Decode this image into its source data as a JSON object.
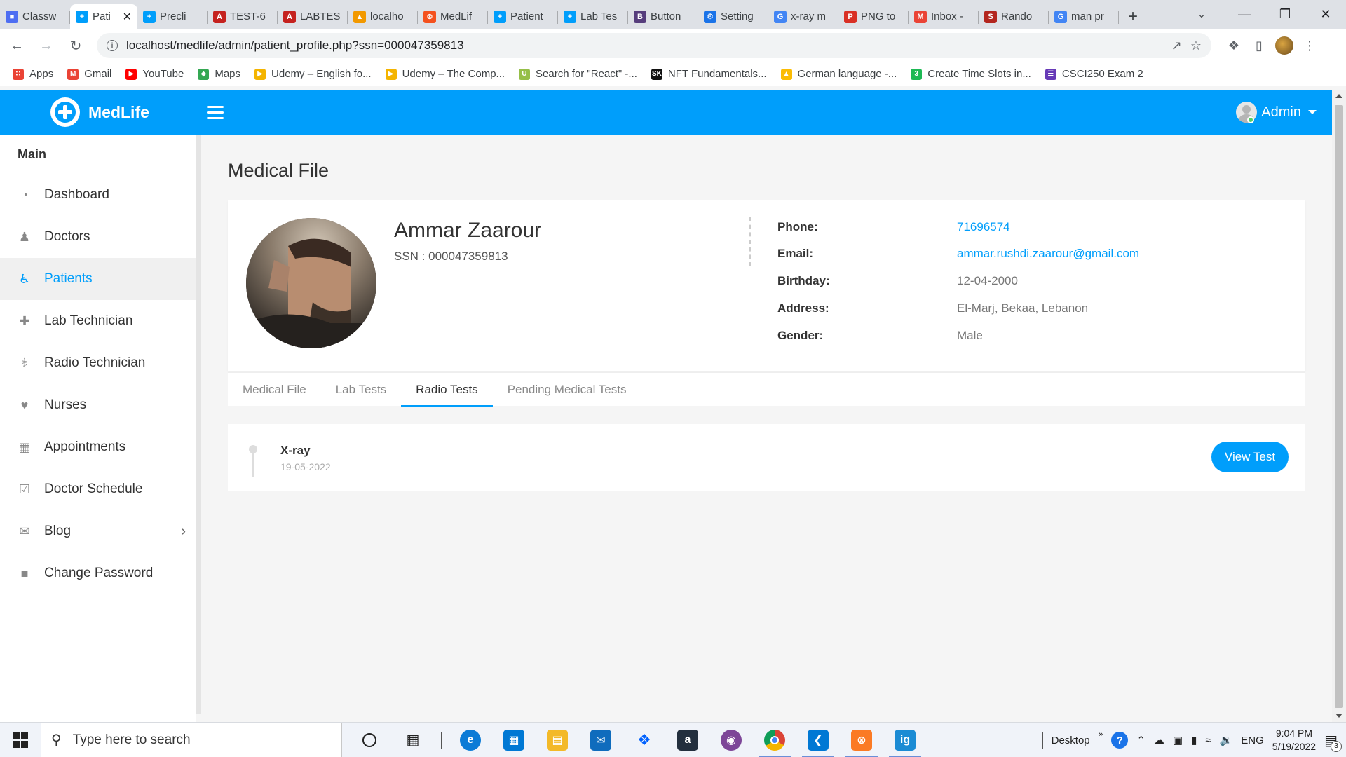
{
  "browser": {
    "tabs": [
      {
        "label": "Classw",
        "color": "#4e6ef2",
        "glyph": "■",
        "active": false
      },
      {
        "label": "Pati",
        "color": "#009efb",
        "glyph": "+",
        "active": true
      },
      {
        "label": "Precli",
        "color": "#009efb",
        "glyph": "+",
        "active": false
      },
      {
        "label": "TEST-6",
        "color": "#c5221f",
        "glyph": "A",
        "active": false
      },
      {
        "label": "LABTES",
        "color": "#c5221f",
        "glyph": "A",
        "active": false
      },
      {
        "label": "localho",
        "color": "#f29900",
        "glyph": "▲",
        "active": false
      },
      {
        "label": "MedLif",
        "color": "#f4511e",
        "glyph": "⊗",
        "active": false
      },
      {
        "label": "Patient",
        "color": "#009efb",
        "glyph": "+",
        "active": false
      },
      {
        "label": "Lab Tes",
        "color": "#009efb",
        "glyph": "+",
        "active": false
      },
      {
        "label": "Button",
        "color": "#563d7c",
        "glyph": "B",
        "active": false
      },
      {
        "label": "Setting",
        "color": "#1a73e8",
        "glyph": "⚙",
        "active": false
      },
      {
        "label": "x-ray m",
        "color": "#4285f4",
        "glyph": "G",
        "active": false
      },
      {
        "label": "PNG to",
        "color": "#d93025",
        "glyph": "P",
        "active": false
      },
      {
        "label": "Inbox -",
        "color": "#ea4335",
        "glyph": "M",
        "active": false
      },
      {
        "label": "Rando",
        "color": "#b3261e",
        "glyph": "S",
        "active": false
      },
      {
        "label": "man pr",
        "color": "#4285f4",
        "glyph": "G",
        "active": false
      }
    ],
    "url": "localhost/medlife/admin/patient_profile.php?ssn=000047359813",
    "bookmarks": [
      {
        "label": "Apps",
        "color": "#ea4335",
        "glyph": "∷"
      },
      {
        "label": "Gmail",
        "color": "#ea4335",
        "glyph": "M"
      },
      {
        "label": "YouTube",
        "color": "#ff0000",
        "glyph": "▶"
      },
      {
        "label": "Maps",
        "color": "#34a853",
        "glyph": "◆"
      },
      {
        "label": "Udemy – English fo...",
        "color": "#f4b400",
        "glyph": "▶"
      },
      {
        "label": "Udemy – The Comp...",
        "color": "#f4b400",
        "glyph": "▶"
      },
      {
        "label": "Search for \"React\" -...",
        "color": "#96bf48",
        "glyph": "U"
      },
      {
        "label": "NFT Fundamentals...",
        "color": "#111111",
        "glyph": "SK"
      },
      {
        "label": "German language -...",
        "color": "#fbbc04",
        "glyph": "▲"
      },
      {
        "label": "Create Time Slots in...",
        "color": "#1db954",
        "glyph": "3"
      },
      {
        "label": "CSCI250 Exam 2",
        "color": "#673ab7",
        "glyph": "☰"
      }
    ]
  },
  "app": {
    "logo_text": "MedLife",
    "user_label": "Admin",
    "brand_color": "#009efb"
  },
  "sidebar": {
    "section_title": "Main",
    "items": [
      {
        "label": "Dashboard",
        "icon": "dashboard-icon",
        "glyph": "◔",
        "active": false
      },
      {
        "label": "Doctors",
        "icon": "doctor-icon",
        "glyph": "♟",
        "active": false
      },
      {
        "label": "Patients",
        "icon": "wheelchair-icon",
        "glyph": "♿",
        "active": true
      },
      {
        "label": "Lab Technician",
        "icon": "medkit-icon",
        "glyph": "✚",
        "active": false
      },
      {
        "label": "Radio Technician",
        "icon": "stethoscope-icon",
        "glyph": "⚕",
        "active": false
      },
      {
        "label": "Nurses",
        "icon": "heartbeat-icon",
        "glyph": "♥",
        "active": false
      },
      {
        "label": "Appointments",
        "icon": "calendar-icon",
        "glyph": "▦",
        "active": false
      },
      {
        "label": "Doctor Schedule",
        "icon": "calendar-check-icon",
        "glyph": "☑",
        "active": false
      },
      {
        "label": "Blog",
        "icon": "comment-icon",
        "glyph": "✉",
        "active": false,
        "has_submenu": true
      },
      {
        "label": "Change Password",
        "icon": "lock-icon",
        "glyph": "■",
        "active": false
      }
    ]
  },
  "main": {
    "page_title": "Medical File",
    "patient": {
      "name": "Ammar Zaarour",
      "ssn_text": "SSN : 000047359813",
      "phone_label": "Phone:",
      "phone": "71696574",
      "email_label": "Email:",
      "email": "ammar.rushdi.zaarour@gmail.com",
      "birthday_label": "Birthday:",
      "birthday": "12-04-2000",
      "address_label": "Address:",
      "address": "El-Marj, Bekaa, Lebanon",
      "gender_label": "Gender:",
      "gender": "Male"
    },
    "tabs": [
      {
        "label": "Medical File",
        "active": false
      },
      {
        "label": "Lab Tests",
        "active": false
      },
      {
        "label": "Radio Tests",
        "active": true
      },
      {
        "label": "Pending Medical Tests",
        "active": false
      }
    ],
    "tests": [
      {
        "name": "X-ray",
        "date": "19-05-2022",
        "button_label": "View Test"
      }
    ]
  },
  "taskbar": {
    "search_placeholder": "Type here to search",
    "desktop_label": "Desktop",
    "language": "ENG",
    "time": "9:04 PM",
    "date": "5/19/2022",
    "notification_count": "3"
  }
}
